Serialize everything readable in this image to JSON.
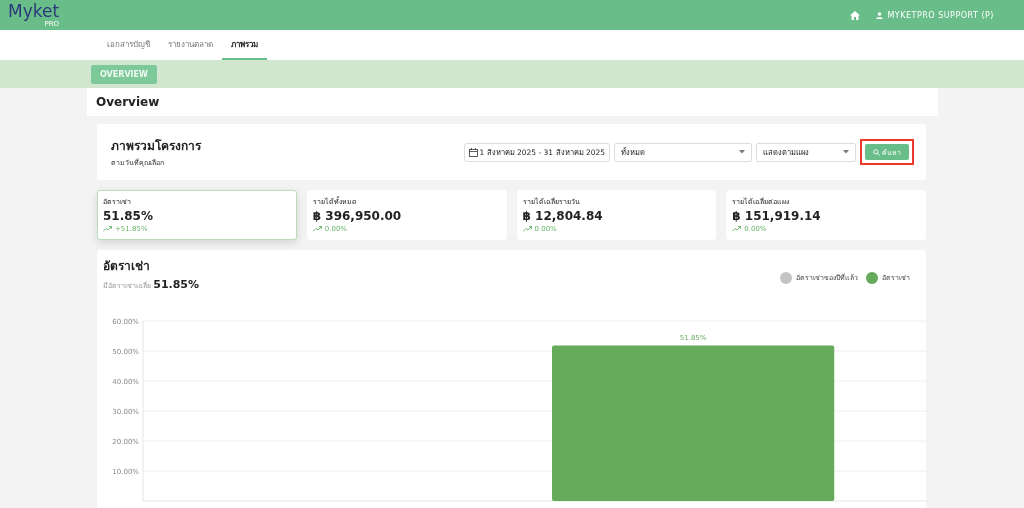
{
  "header": {
    "logo": "Myket",
    "logo_badge": "PRO",
    "user": "MYKETPRO SUPPORT (P)"
  },
  "tabs": [
    {
      "label": "เอกสารบัญชี",
      "selected": false
    },
    {
      "label": "รายงานตลาด",
      "selected": false
    },
    {
      "label": "ภาพรวม",
      "selected": true
    }
  ],
  "subnav": {
    "button": "OVERVIEW"
  },
  "page_title": "Overview",
  "filter_card": {
    "title": "ภาพรวมโครงการ",
    "subtitle": "ตามวันที่คุณเลือก",
    "date_range": "1 สิงหาคม 2025 - 31 สิงหาคม 2025",
    "select_1": "ทั้งหมด",
    "select_2": "แสดงตามแผง",
    "search_button": {
      "label": "ค้นหา",
      "highlighted": true
    }
  },
  "stats": [
    {
      "label": "อัตราเช่า",
      "value": "51.85%",
      "change": "+51.85%",
      "selected": true
    },
    {
      "label": "รายได้ทั้งหมด",
      "value": "฿ 396,950.00",
      "change": "0.00%",
      "selected": false
    },
    {
      "label": "รายได้เฉลี่ยรายวัน",
      "value": "฿ 12,804.84",
      "change": "0.00%",
      "selected": false
    },
    {
      "label": "รายได้เฉลี่ยต่อแผง",
      "value": "฿ 151,919.14",
      "change": "0.00%",
      "selected": false
    }
  ],
  "chart_card": {
    "title": "อัตราเช่า",
    "avg_label": "มีอัตราเช่าเฉลี่ย",
    "avg_value": "51.85%",
    "chart_data": {
      "type": "bar",
      "grid": true,
      "ylim": [
        0,
        60
      ],
      "yticks": [
        {
          "value": 10,
          "label": "10.00%"
        },
        {
          "value": 20,
          "label": "20.00%"
        },
        {
          "value": 30,
          "label": "30.00%"
        },
        {
          "value": 40,
          "label": "40.00%"
        },
        {
          "value": 50,
          "label": "50.00%"
        },
        {
          "value": 60,
          "label": "60.00%"
        }
      ],
      "series": [
        {
          "name": "อัตราเช่าของปีที่แล้ว",
          "color": "#c4c4c4",
          "values": [
            null
          ]
        },
        {
          "name": "อัตราเช่า",
          "color": "#66aa5c",
          "values": [
            51.85
          ]
        }
      ],
      "value_labels": [
        "51.85%"
      ]
    }
  }
}
